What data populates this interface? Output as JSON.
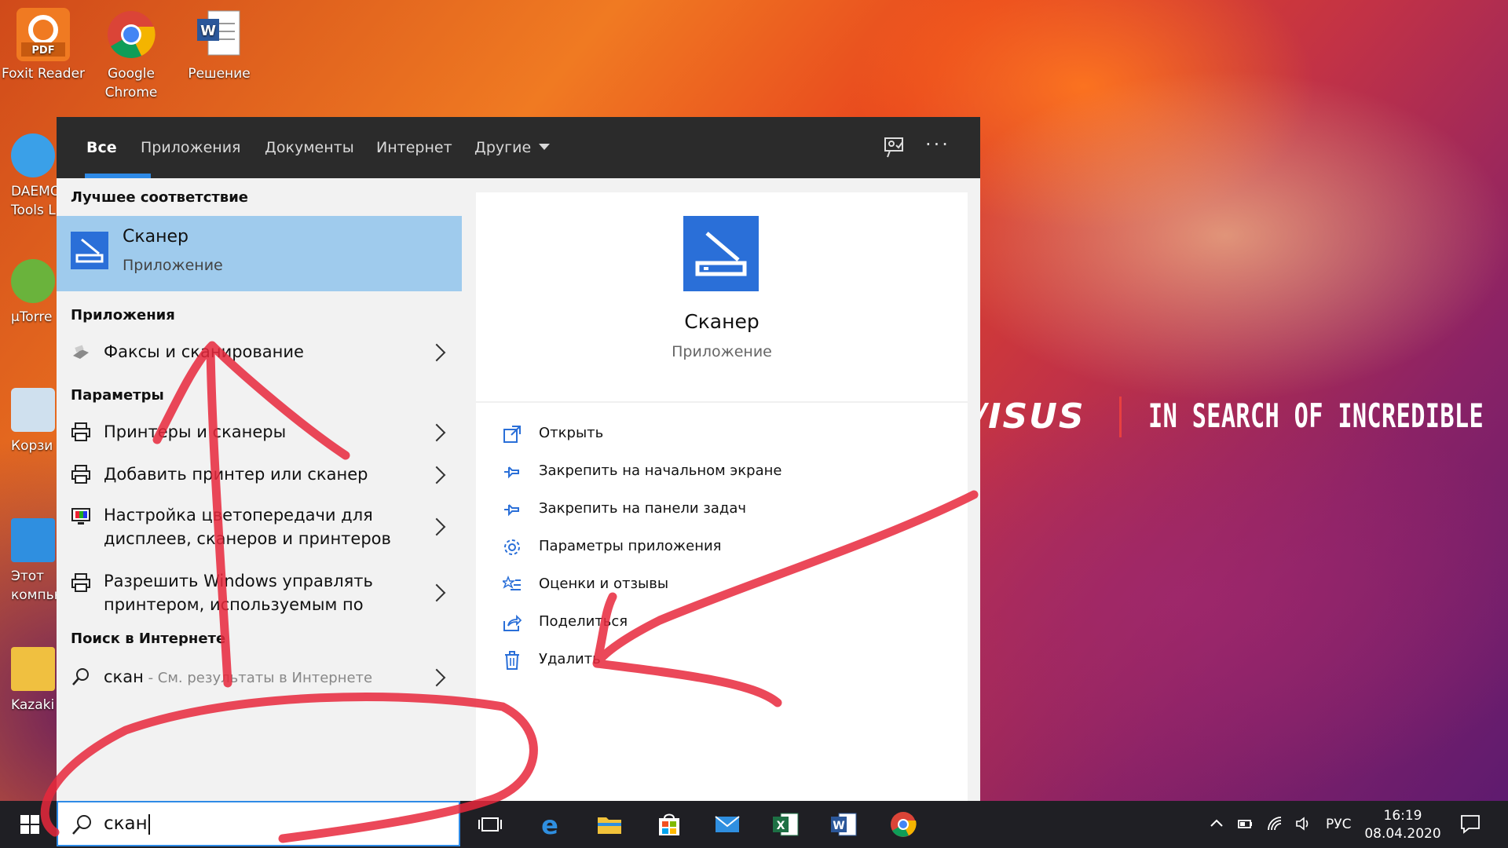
{
  "desktop": {
    "icons": [
      {
        "label_line1": "Foxit Reader",
        "label_line2": "",
        "icon": "foxit-reader-icon"
      },
      {
        "label_line1": "Google",
        "label_line2": "Chrome",
        "icon": "google-chrome-icon"
      },
      {
        "label_line1": "Решение",
        "label_line2": "",
        "icon": "word-document-icon"
      }
    ],
    "left_icons": [
      {
        "label_line1": "DAEMO",
        "label_line2": "Tools L",
        "icon": "daemon-tools-icon"
      },
      {
        "label_line1": "µTorre",
        "label_line2": "",
        "icon": "utorrent-icon"
      },
      {
        "label_line1": "Корзи",
        "label_line2": "",
        "icon": "recycle-bin-icon"
      },
      {
        "label_line1": "Этот",
        "label_line2": "компью",
        "icon": "this-pc-icon"
      },
      {
        "label_line1": "Kazaki",
        "label_line2": "",
        "icon": "folder-icon"
      }
    ],
    "wallpaper": {
      "brand": "/ISUS",
      "slogan": "IN SEARCH OF INCREDIBLE"
    }
  },
  "search_panel": {
    "tabs": [
      {
        "label": "Все",
        "active": true
      },
      {
        "label": "Приложения",
        "active": false
      },
      {
        "label": "Документы",
        "active": false
      },
      {
        "label": "Интернет",
        "active": false
      },
      {
        "label": "Другие",
        "active": false
      }
    ],
    "best_match": {
      "heading": "Лучшее соответствие",
      "title": "Сканер",
      "subtitle": "Приложение"
    },
    "apps": {
      "heading": "Приложения",
      "items": [
        {
          "label": "Факсы и сканирование",
          "icon": "fax-scan-icon"
        }
      ]
    },
    "settings": {
      "heading": "Параметры",
      "items": [
        {
          "line1": "Принтеры и сканеры",
          "line2": "",
          "icon": "printer-icon"
        },
        {
          "line1": "Добавить принтер или сканер",
          "line2": "",
          "icon": "printer-icon"
        },
        {
          "line1": "Настройка цветопередачи для",
          "line2": "дисплеев, сканеров и принтеров",
          "icon": "display-color-icon"
        },
        {
          "line1": "Разрешить Windows управлять",
          "line2": "принтером, используемым по",
          "icon": "printer-icon"
        }
      ]
    },
    "web": {
      "heading": "Поиск в Интернете",
      "query": "скан",
      "suffix": " - См. результаты в Интернете"
    },
    "detail": {
      "title": "Сканер",
      "subtitle": "Приложение",
      "actions": [
        {
          "label": "Открыть",
          "icon": "open-icon"
        },
        {
          "label": "Закрепить на начальном экране",
          "icon": "pin-icon"
        },
        {
          "label": "Закрепить на панели задач",
          "icon": "pin-icon"
        },
        {
          "label": "Параметры приложения",
          "icon": "gear-icon"
        },
        {
          "label": "Оценки и отзывы",
          "icon": "star-list-icon"
        },
        {
          "label": "Поделиться",
          "icon": "share-icon"
        },
        {
          "label": "Удалить",
          "icon": "trash-icon"
        }
      ]
    }
  },
  "taskbar": {
    "search_value": "скан",
    "apps": [
      "task-view-icon",
      "edge-icon",
      "file-explorer-icon",
      "store-icon",
      "mail-icon",
      "excel-icon",
      "word-icon",
      "chrome-icon"
    ],
    "language": "РУС",
    "time": "16:19",
    "date": "08.04.2020"
  },
  "colors": {
    "accent": "#2e8ae6",
    "best_match_bg": "#9fcbed",
    "scanner_icon_bg": "#2a6fd8",
    "annotation": "#e8283c"
  }
}
